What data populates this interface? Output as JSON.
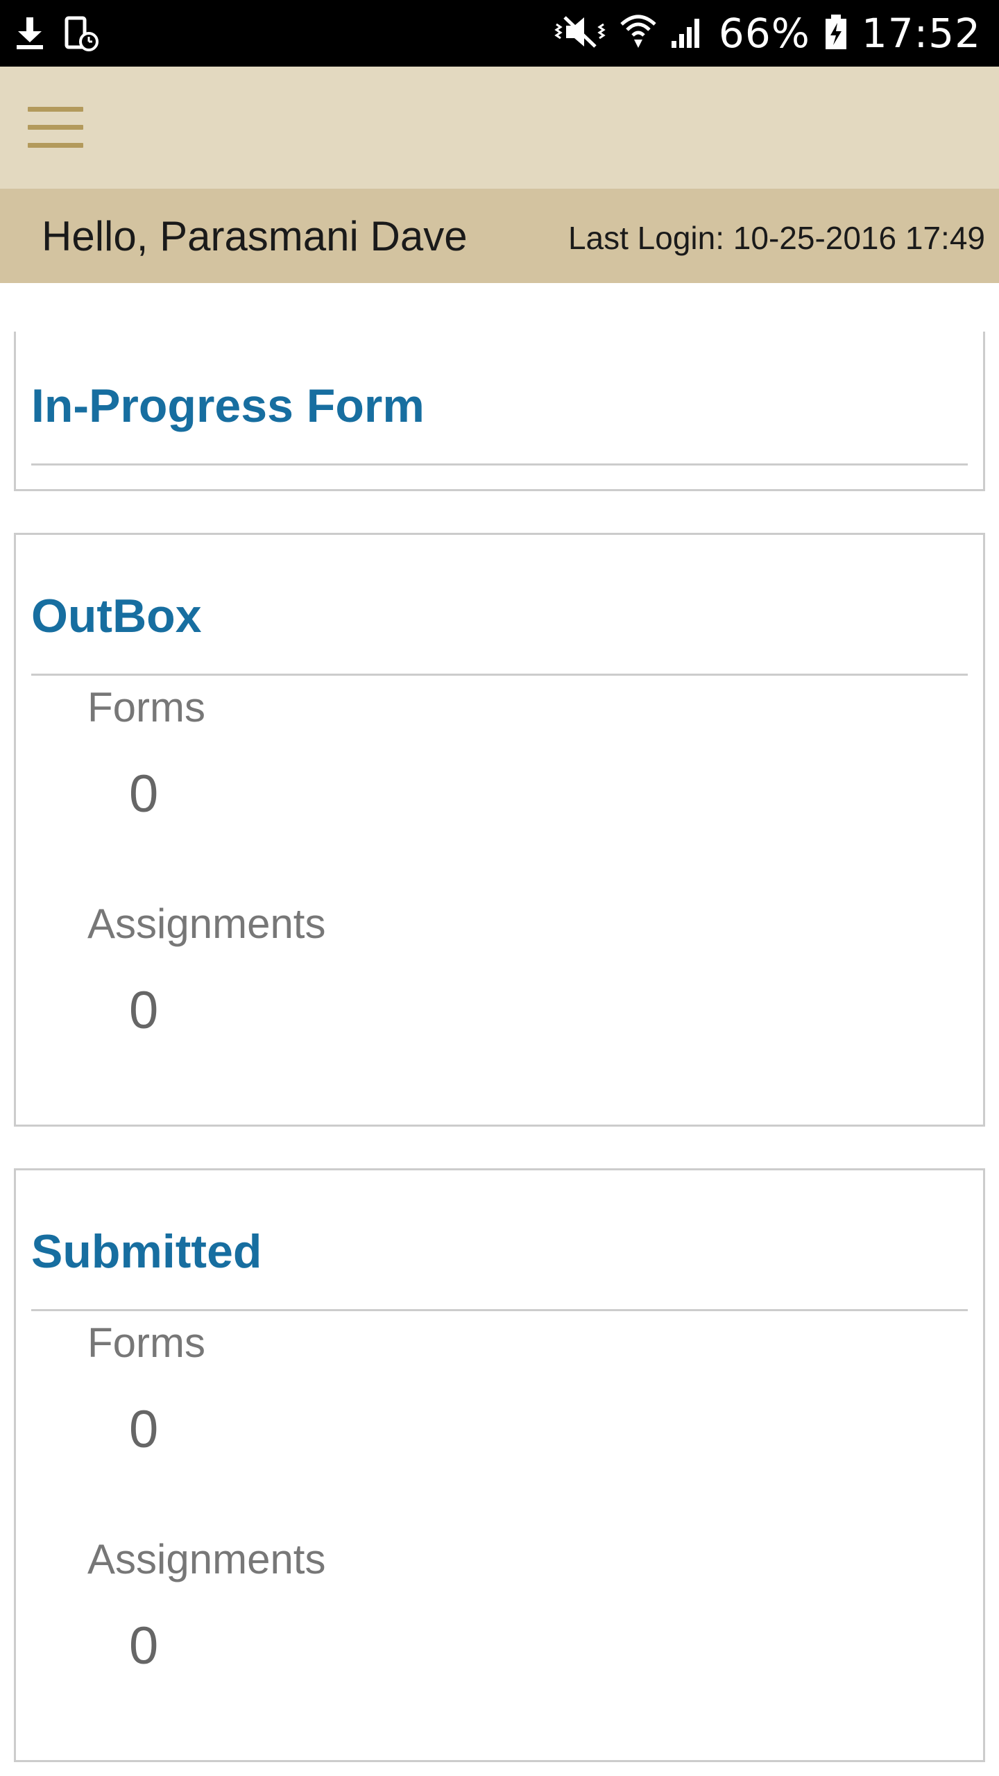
{
  "status_bar": {
    "battery": "66%",
    "time": "17:52",
    "icons": [
      "download-icon",
      "device-clock-icon",
      "vibrate-mute-icon",
      "wifi-icon",
      "signal-icon",
      "battery-charging-icon"
    ]
  },
  "toolbar": {
    "menu_icon": "hamburger-menu-icon"
  },
  "welcome": {
    "greeting": "Hello, Parasmani Dave",
    "last_login": "Last Login: 10-25-2016 17:49"
  },
  "sections": {
    "in_progress": {
      "title": "In-Progress Form"
    },
    "outbox": {
      "title": "OutBox",
      "forms_label": "Forms",
      "forms_value": "0",
      "assignments_label": "Assignments",
      "assignments_value": "0"
    },
    "submitted": {
      "title": "Submitted",
      "forms_label": "Forms",
      "forms_value": "0",
      "assignments_label": "Assignments",
      "assignments_value": "0"
    }
  },
  "colors": {
    "status_bar": "#000000",
    "toolbar": "#e3d9c0",
    "welcome_bar": "#d3c3a0",
    "menu_icon": "#b39a5c",
    "section_title": "#176ea0",
    "stat_text": "#777777",
    "card_border": "#cccccc"
  }
}
